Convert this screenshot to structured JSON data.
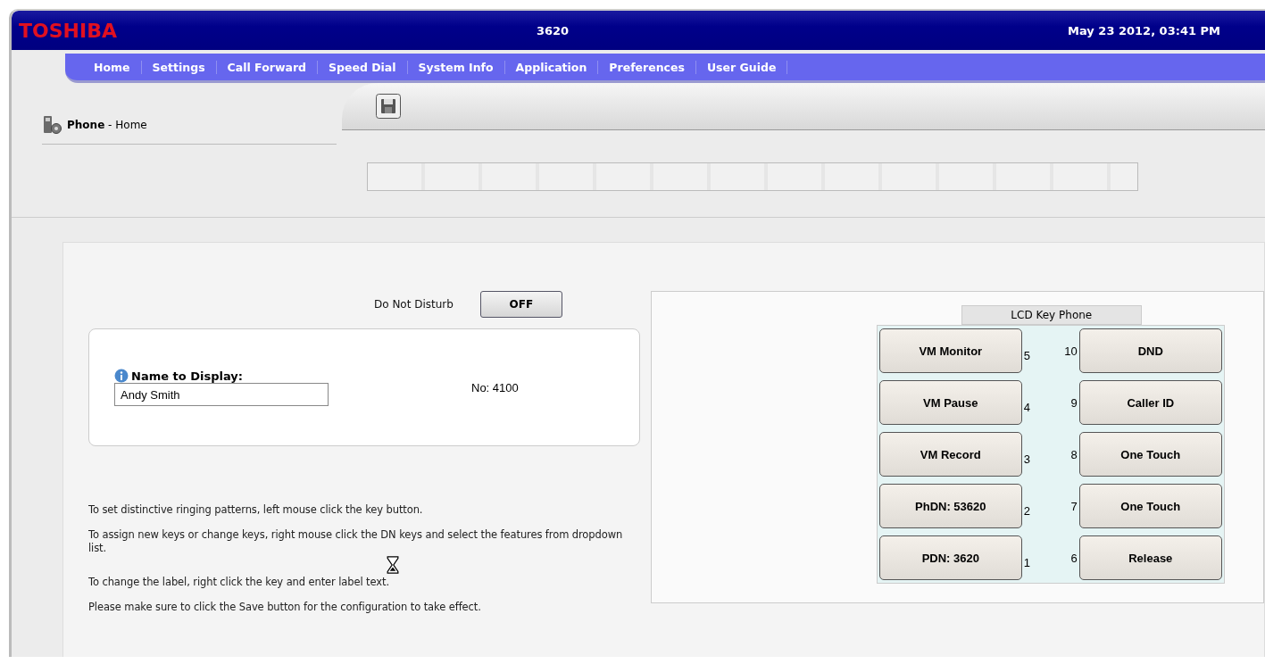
{
  "header": {
    "brand": "TOSHIBA",
    "extension": "3620",
    "datetime": "May 23 2012, 03:41 PM"
  },
  "nav": [
    "Home",
    "Settings",
    "Call Forward",
    "Speed Dial",
    "System Info",
    "Application",
    "Preferences",
    "User Guide"
  ],
  "breadcrumb": {
    "section": "Phone",
    "separator": "-",
    "page": "Home"
  },
  "dnd": {
    "label": "Do Not Disturb",
    "button": "OFF"
  },
  "name_card": {
    "label": "Name to Display:",
    "value": "Andy Smith",
    "number": "No: 4100"
  },
  "help": [
    "To set distinctive ringing patterns, left mouse click the key button.",
    "To assign new keys or change keys, right mouse click the DN keys and select the features from dropdown list.",
    "To change the label, right click the key and enter label text.",
    "Please make sure to click the Save button for the configuration to take effect."
  ],
  "phone": {
    "title": "LCD Key Phone",
    "rows": [
      {
        "left": {
          "label": "VM Monitor",
          "number": "5"
        },
        "right": {
          "label": "DND",
          "number": "10"
        }
      },
      {
        "left": {
          "label": "VM Pause",
          "number": "4"
        },
        "right": {
          "label": "Caller ID",
          "number": "9"
        }
      },
      {
        "left": {
          "label": "VM Record",
          "number": "3"
        },
        "right": {
          "label": "One Touch",
          "number": "8"
        }
      },
      {
        "left": {
          "label": "PhDN: 53620",
          "number": "2"
        },
        "right": {
          "label": "One Touch",
          "number": "7"
        }
      },
      {
        "left": {
          "label": "PDN: 3620",
          "number": "1"
        },
        "right": {
          "label": "Release",
          "number": "6"
        }
      }
    ]
  }
}
